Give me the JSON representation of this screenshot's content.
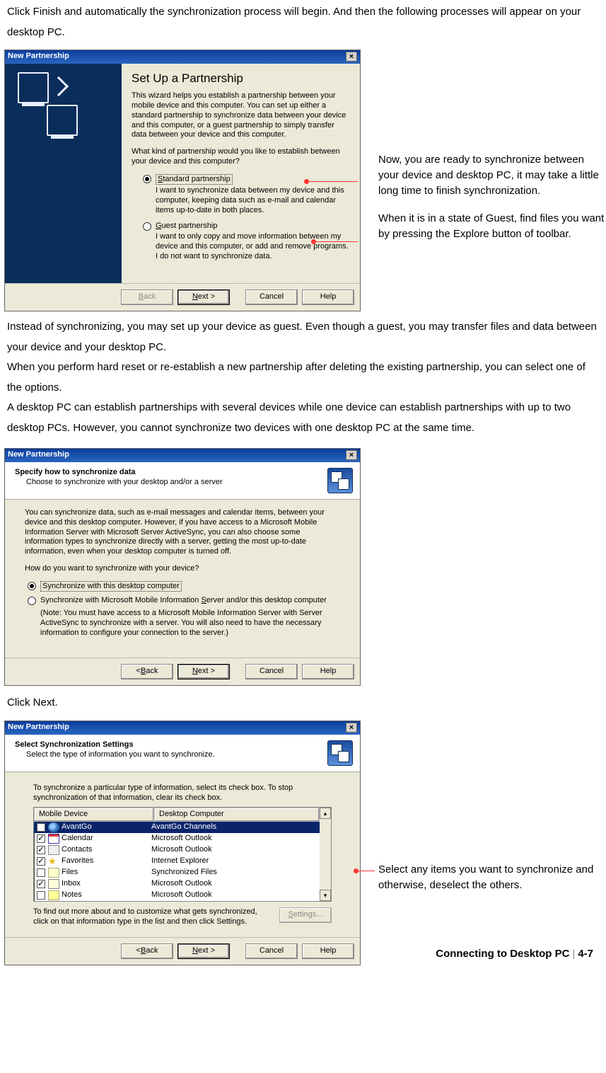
{
  "para1": "Click Finish and automatically the synchronization process will begin. And then the following processes will appear on your desktop PC.",
  "dialog1": {
    "title": "New Partnership",
    "heading": "Set Up a Partnership",
    "intro": "This wizard helps you establish a partnership between your mobile device and this computer.  You can set up either a standard partnership to synchronize data between your device and this computer, or a guest partnership to simply transfer data between your device and this computer.",
    "question": "What kind of partnership would you like to establish between your device and this computer?",
    "opt1_label_s": "S",
    "opt1_label_rest": "tandard partnership",
    "opt1_desc": "I want to synchronize data between my device and this computer, keeping data such as e-mail and calendar items up-to-date in both places.",
    "opt2_label_g": "G",
    "opt2_label_rest": "uest partnership",
    "opt2_desc": "I want to only copy and move information between my device and this computer, or add and remove programs.  I do not want to synchronize data.",
    "btn_back": "< Back",
    "btn_next": "Next >",
    "btn_cancel": "Cancel",
    "btn_help": "Help"
  },
  "callout1": "Now, you are ready to synchronize between your device and desktop PC, it may take a little long time to finish synchronization.",
  "callout2": "When it is in a state of Guest, find files you want by pressing the Explore button of toolbar.",
  "para2": "Instead of synchronizing, you may set up your device as guest. Even though a guest, you may transfer files and data between your device and your desktop PC.",
  "para3": "When you perform hard reset or re-establish a new partnership after deleting the existing partnership, you can select one of the options.",
  "para4": "A desktop PC can establish partnerships with several devices while one device can establish partnerships with up to two desktop PCs. However, you cannot synchronize two devices with one desktop PC at the same time.",
  "dialog2": {
    "title": "New Partnership",
    "head_bold": "Specify how to synchronize data",
    "head_sub": "Choose to synchronize with your desktop and/or a server",
    "body1": "You can synchronize data, such as e-mail messages and calendar items, between your device and this desktop computer.  However, if you have access to a Microsoft Mobile Information Server with Microsoft Server ActiveSync, you can also choose some information types to synchronize directly with a server, getting the most up-to-date information, even when your desktop computer is turned off.",
    "body2": "How do you want to synchronize with your device?",
    "opt1": "Synchronize with this desktop computer",
    "opt2_a": "Synchronize with Microsoft Mobile Information ",
    "opt2_s": "S",
    "opt2_b": "erver and/or this desktop computer",
    "note": "(Note: You must have access to a Microsoft Mobile Information Server with Server ActiveSync to synchronize with a server.  You will also need to have the necessary information to configure your connection to the server.)",
    "btn_back": "< Back",
    "btn_next": "Next >",
    "btn_cancel": "Cancel",
    "btn_help": "Help"
  },
  "para5": "Click Next.",
  "dialog3": {
    "title": "New Partnership",
    "head_bold": "Select Synchronization Settings",
    "head_sub": "Select the type of information you want to synchronize.",
    "intro": "To synchronize a particular type of information, select its check box. To stop synchronization of that information, clear its check box.",
    "col1": "Mobile Device",
    "col2": "Desktop Computer",
    "rows": [
      {
        "checked": false,
        "name": "AvantGo",
        "desk": "AvantGo Channels",
        "sel": true,
        "ico": "globe"
      },
      {
        "checked": true,
        "name": "Calendar",
        "desk": "Microsoft Outlook",
        "ico": "cal"
      },
      {
        "checked": true,
        "name": "Contacts",
        "desk": "Microsoft Outlook",
        "ico": "contact"
      },
      {
        "checked": true,
        "name": "Favorites",
        "desk": "Internet Explorer",
        "ico": "star"
      },
      {
        "checked": false,
        "name": "Files",
        "desk": "Synchronized Files",
        "ico": "files"
      },
      {
        "checked": true,
        "name": "Inbox",
        "desk": "Microsoft Outlook",
        "ico": "inbox"
      },
      {
        "checked": false,
        "name": "Notes",
        "desk": "Microsoft Outlook",
        "ico": "notes"
      }
    ],
    "hint": "To find out more about and to customize what gets synchronized, click on that information type in the list and then click Settings.",
    "btn_settings": "Settings...",
    "btn_back": "< Back",
    "btn_next": "Next >",
    "btn_cancel": "Cancel",
    "btn_help": "Help"
  },
  "callout3": "Select any items you want to synchronize and otherwise, deselect the others.",
  "footer_text": "Connecting to Desktop PC",
  "footer_page": "4-7"
}
